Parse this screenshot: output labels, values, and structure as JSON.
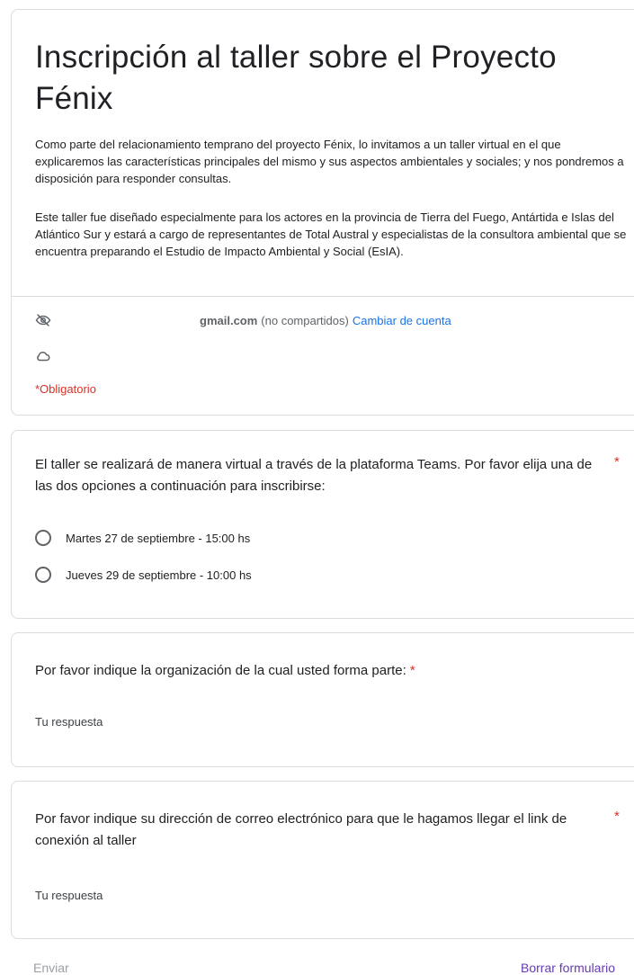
{
  "form": {
    "title": "Inscripción al taller sobre el Proyecto Fénix",
    "description_1": "Como parte del relacionamiento temprano del proyecto Fénix, lo invitamos a un taller virtual en el que explicaremos las características principales del mismo y sus aspectos ambientales y sociales; y nos pondremos a disposición para responder consultas.",
    "description_2": "Este taller fue diseñado especialmente para los actores en la provincia de Tierra del Fuego, Antártida e Islas del Atlántico Sur y estará a cargo de representantes de Total Austral y especialistas de la consultora ambiental que se encuentra preparando el Estudio de Impacto Ambiental y Social (EsIA).",
    "account_email": "gmail.com",
    "account_shared_note": "(no compartidos)",
    "switch_account": "Cambiar de cuenta",
    "required_note": "*Obligatorio"
  },
  "questions": [
    {
      "text": "El taller se realizará de manera virtual a través de la plataforma Teams. Por favor elija una de las dos opciones a continuación para inscribirse:",
      "required_mark": "*",
      "options": [
        "Martes 27 de septiembre - 15:00 hs",
        "Jueves 29 de septiembre - 10:00 hs"
      ]
    },
    {
      "text": "Por favor indique la organización de la cual usted forma parte:",
      "required_mark": "*",
      "placeholder": "Tu respuesta"
    },
    {
      "text": "Por favor indique su dirección de correo electrónico para que le hagamos llegar el link de conexión al taller",
      "required_mark": "*",
      "placeholder": "Tu respuesta"
    }
  ],
  "footer": {
    "submit": "Enviar",
    "clear": "Borrar formulario"
  },
  "colors": {
    "required": "#d93025",
    "link": "#1a73e8",
    "clear_button": "#673ab7",
    "border": "#dadce0"
  },
  "icons": [
    "eye-slash-icon",
    "cloud-check-icon"
  ]
}
